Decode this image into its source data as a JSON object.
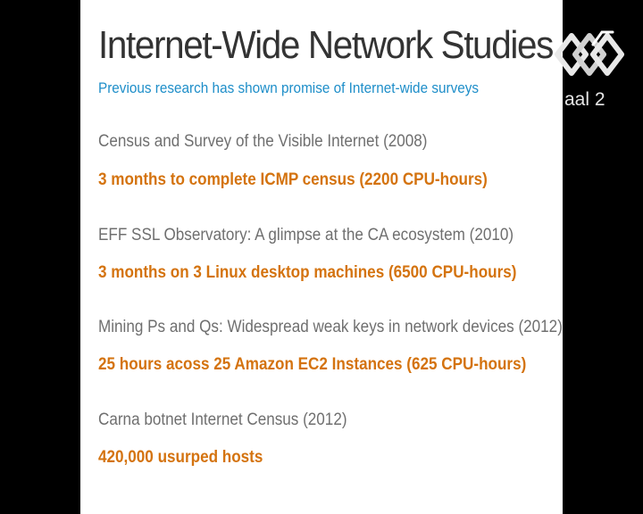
{
  "slide": {
    "title": "Internet-Wide Network Studies",
    "subtitle": "Previous research has shown promise of Internet-wide surveys",
    "studies": [
      {
        "title": "Census and Survey of the Visible Internet (2008)",
        "detail": "3 months to complete ICMP census (2200 CPU-hours)"
      },
      {
        "title": "EFF SSL Observatory: A glimpse at the CA ecosystem (2010)",
        "detail": "3 months on 3 Linux desktop machines (6500 CPU-hours)"
      },
      {
        "title": "Mining Ps and Qs: Widespread weak keys in network devices (2012)",
        "detail": "25 hours acoss 25 Amazon EC2 Instances (625 CPU-hours)"
      },
      {
        "title": "Carna botnet Internet Census (2012)",
        "detail": "420,000 usurped hosts"
      }
    ]
  },
  "overlay": {
    "logo_icon": "channel-logo-icon",
    "channel_label": "aal 2"
  },
  "colors": {
    "background": "#000000",
    "slide": "#ffffff",
    "title": "#333333",
    "subtitle": "#1e8ec9",
    "study_title": "#6f6f6f",
    "study_detail": "#d4730f"
  }
}
